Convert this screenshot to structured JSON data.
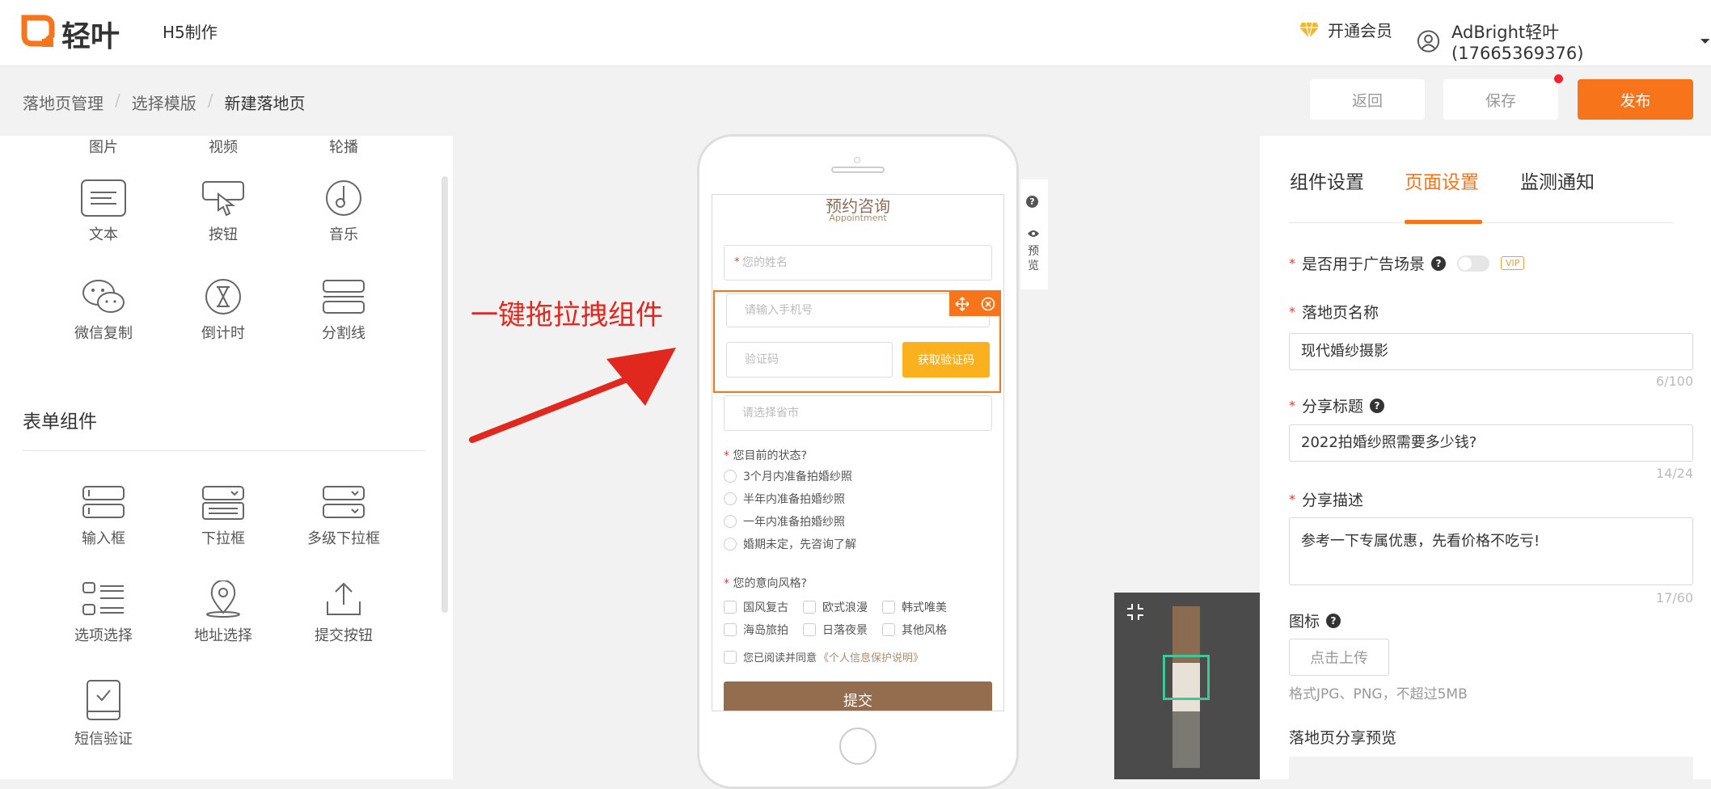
{
  "header": {
    "brand": "轻叶",
    "h5": "H5制作",
    "vip": "开通会员",
    "user": "AdBright轻叶 (17665369376)"
  },
  "breadcrumb": [
    "落地页管理",
    "选择模版",
    "新建落地页"
  ],
  "actions": {
    "back": "返回",
    "save": "保存",
    "publish": "发布"
  },
  "left": {
    "top_labels": [
      "图片",
      "视频",
      "轮播"
    ],
    "basic": [
      "文本",
      "按钮",
      "音乐",
      "微信复制",
      "倒计时",
      "分割线"
    ],
    "form_title": "表单组件",
    "form": [
      "输入框",
      "下拉框",
      "多级下拉框",
      "选项选择",
      "地址选择",
      "提交按钮",
      "短信验证"
    ]
  },
  "annotation": "一键拖拉拽组件",
  "phone": {
    "title": "预约咨询",
    "subtitle": "Appointment",
    "name_ph": "您的姓名",
    "phone_ph": "请输入手机号",
    "code_ph": "验证码",
    "code_btn": "获取验证码",
    "region_ph": "请选择省市",
    "q1": "您目前的状态?",
    "q1_opts": [
      "3个月内准备拍婚纱照",
      "半年内准备拍婚纱照",
      "一年内准备拍婚纱照",
      "婚期未定，先咨询了解"
    ],
    "q2": "您的意向风格?",
    "q2_opts": [
      "国风复古",
      "欧式浪漫",
      "韩式唯美",
      "海岛旅拍",
      "日落夜景",
      "其他风格"
    ],
    "agree": "您已阅读并同意",
    "agree_link": "《个人信息保护说明》",
    "submit": "提交",
    "side_help": "?",
    "side_preview": "预览"
  },
  "right": {
    "tabs": [
      "组件设置",
      "页面设置",
      "监测通知"
    ],
    "ad_label": "是否用于广告场景",
    "vip_badge": "VIP",
    "name_label": "落地页名称",
    "name_value": "现代婚纱摄影",
    "name_count": "6/100",
    "share_title_label": "分享标题",
    "share_title_value": "2022拍婚纱照需要多少钱?",
    "share_title_count": "14/24",
    "share_desc_label": "分享描述",
    "share_desc_value": "参考一下专属优惠，先看价格不吃亏!",
    "share_desc_count": "17/60",
    "icon_label": "图标",
    "upload": "点击上传",
    "hint": "格式JPG、PNG，不超过5MB",
    "share_preview": "落地页分享预览"
  }
}
